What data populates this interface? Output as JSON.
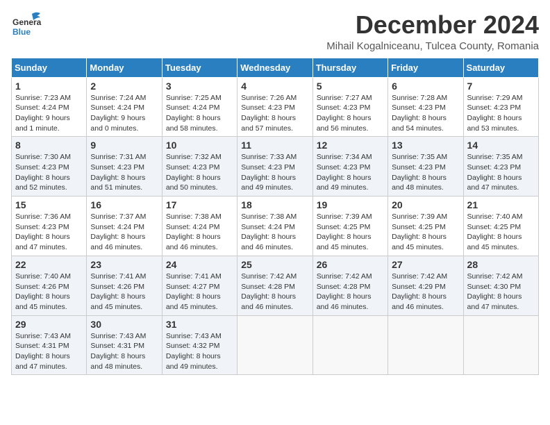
{
  "logo": {
    "general": "General",
    "blue": "Blue"
  },
  "title": "December 2024",
  "subtitle": "Mihail Kogalniceanu, Tulcea County, Romania",
  "weekdays": [
    "Sunday",
    "Monday",
    "Tuesday",
    "Wednesday",
    "Thursday",
    "Friday",
    "Saturday"
  ],
  "weeks": [
    [
      {
        "day": "1",
        "sunrise": "Sunrise: 7:23 AM",
        "sunset": "Sunset: 4:24 PM",
        "daylight": "Daylight: 9 hours and 1 minute."
      },
      {
        "day": "2",
        "sunrise": "Sunrise: 7:24 AM",
        "sunset": "Sunset: 4:24 PM",
        "daylight": "Daylight: 9 hours and 0 minutes."
      },
      {
        "day": "3",
        "sunrise": "Sunrise: 7:25 AM",
        "sunset": "Sunset: 4:24 PM",
        "daylight": "Daylight: 8 hours and 58 minutes."
      },
      {
        "day": "4",
        "sunrise": "Sunrise: 7:26 AM",
        "sunset": "Sunset: 4:23 PM",
        "daylight": "Daylight: 8 hours and 57 minutes."
      },
      {
        "day": "5",
        "sunrise": "Sunrise: 7:27 AM",
        "sunset": "Sunset: 4:23 PM",
        "daylight": "Daylight: 8 hours and 56 minutes."
      },
      {
        "day": "6",
        "sunrise": "Sunrise: 7:28 AM",
        "sunset": "Sunset: 4:23 PM",
        "daylight": "Daylight: 8 hours and 54 minutes."
      },
      {
        "day": "7",
        "sunrise": "Sunrise: 7:29 AM",
        "sunset": "Sunset: 4:23 PM",
        "daylight": "Daylight: 8 hours and 53 minutes."
      }
    ],
    [
      {
        "day": "8",
        "sunrise": "Sunrise: 7:30 AM",
        "sunset": "Sunset: 4:23 PM",
        "daylight": "Daylight: 8 hours and 52 minutes."
      },
      {
        "day": "9",
        "sunrise": "Sunrise: 7:31 AM",
        "sunset": "Sunset: 4:23 PM",
        "daylight": "Daylight: 8 hours and 51 minutes."
      },
      {
        "day": "10",
        "sunrise": "Sunrise: 7:32 AM",
        "sunset": "Sunset: 4:23 PM",
        "daylight": "Daylight: 8 hours and 50 minutes."
      },
      {
        "day": "11",
        "sunrise": "Sunrise: 7:33 AM",
        "sunset": "Sunset: 4:23 PM",
        "daylight": "Daylight: 8 hours and 49 minutes."
      },
      {
        "day": "12",
        "sunrise": "Sunrise: 7:34 AM",
        "sunset": "Sunset: 4:23 PM",
        "daylight": "Daylight: 8 hours and 49 minutes."
      },
      {
        "day": "13",
        "sunrise": "Sunrise: 7:35 AM",
        "sunset": "Sunset: 4:23 PM",
        "daylight": "Daylight: 8 hours and 48 minutes."
      },
      {
        "day": "14",
        "sunrise": "Sunrise: 7:35 AM",
        "sunset": "Sunset: 4:23 PM",
        "daylight": "Daylight: 8 hours and 47 minutes."
      }
    ],
    [
      {
        "day": "15",
        "sunrise": "Sunrise: 7:36 AM",
        "sunset": "Sunset: 4:23 PM",
        "daylight": "Daylight: 8 hours and 47 minutes."
      },
      {
        "day": "16",
        "sunrise": "Sunrise: 7:37 AM",
        "sunset": "Sunset: 4:24 PM",
        "daylight": "Daylight: 8 hours and 46 minutes."
      },
      {
        "day": "17",
        "sunrise": "Sunrise: 7:38 AM",
        "sunset": "Sunset: 4:24 PM",
        "daylight": "Daylight: 8 hours and 46 minutes."
      },
      {
        "day": "18",
        "sunrise": "Sunrise: 7:38 AM",
        "sunset": "Sunset: 4:24 PM",
        "daylight": "Daylight: 8 hours and 46 minutes."
      },
      {
        "day": "19",
        "sunrise": "Sunrise: 7:39 AM",
        "sunset": "Sunset: 4:25 PM",
        "daylight": "Daylight: 8 hours and 45 minutes."
      },
      {
        "day": "20",
        "sunrise": "Sunrise: 7:39 AM",
        "sunset": "Sunset: 4:25 PM",
        "daylight": "Daylight: 8 hours and 45 minutes."
      },
      {
        "day": "21",
        "sunrise": "Sunrise: 7:40 AM",
        "sunset": "Sunset: 4:25 PM",
        "daylight": "Daylight: 8 hours and 45 minutes."
      }
    ],
    [
      {
        "day": "22",
        "sunrise": "Sunrise: 7:40 AM",
        "sunset": "Sunset: 4:26 PM",
        "daylight": "Daylight: 8 hours and 45 minutes."
      },
      {
        "day": "23",
        "sunrise": "Sunrise: 7:41 AM",
        "sunset": "Sunset: 4:26 PM",
        "daylight": "Daylight: 8 hours and 45 minutes."
      },
      {
        "day": "24",
        "sunrise": "Sunrise: 7:41 AM",
        "sunset": "Sunset: 4:27 PM",
        "daylight": "Daylight: 8 hours and 45 minutes."
      },
      {
        "day": "25",
        "sunrise": "Sunrise: 7:42 AM",
        "sunset": "Sunset: 4:28 PM",
        "daylight": "Daylight: 8 hours and 46 minutes."
      },
      {
        "day": "26",
        "sunrise": "Sunrise: 7:42 AM",
        "sunset": "Sunset: 4:28 PM",
        "daylight": "Daylight: 8 hours and 46 minutes."
      },
      {
        "day": "27",
        "sunrise": "Sunrise: 7:42 AM",
        "sunset": "Sunset: 4:29 PM",
        "daylight": "Daylight: 8 hours and 46 minutes."
      },
      {
        "day": "28",
        "sunrise": "Sunrise: 7:42 AM",
        "sunset": "Sunset: 4:30 PM",
        "daylight": "Daylight: 8 hours and 47 minutes."
      }
    ],
    [
      {
        "day": "29",
        "sunrise": "Sunrise: 7:43 AM",
        "sunset": "Sunset: 4:31 PM",
        "daylight": "Daylight: 8 hours and 47 minutes."
      },
      {
        "day": "30",
        "sunrise": "Sunrise: 7:43 AM",
        "sunset": "Sunset: 4:31 PM",
        "daylight": "Daylight: 8 hours and 48 minutes."
      },
      {
        "day": "31",
        "sunrise": "Sunrise: 7:43 AM",
        "sunset": "Sunset: 4:32 PM",
        "daylight": "Daylight: 8 hours and 49 minutes."
      },
      null,
      null,
      null,
      null
    ]
  ]
}
